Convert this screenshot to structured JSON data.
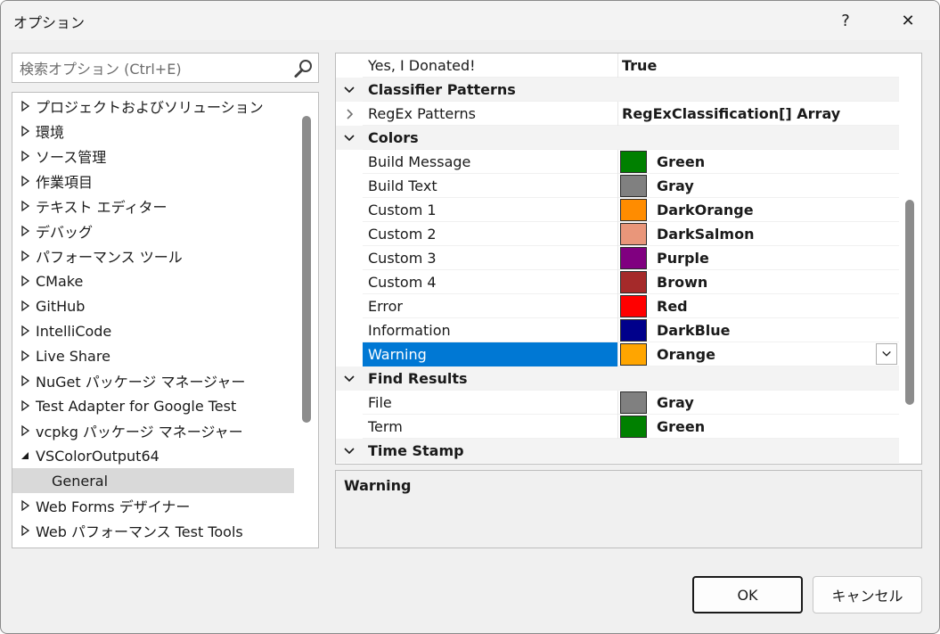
{
  "window": {
    "title": "オプション",
    "help_label": "?",
    "close_label": "✕"
  },
  "search": {
    "placeholder": "検索オプション (Ctrl+E)"
  },
  "tree": {
    "items": [
      {
        "label": "プロジェクトおよびソリューション",
        "state": "collapsed"
      },
      {
        "label": "環境",
        "state": "collapsed"
      },
      {
        "label": "ソース管理",
        "state": "collapsed"
      },
      {
        "label": "作業項目",
        "state": "collapsed"
      },
      {
        "label": "テキスト エディター",
        "state": "collapsed"
      },
      {
        "label": "デバッグ",
        "state": "collapsed"
      },
      {
        "label": "パフォーマンス ツール",
        "state": "collapsed"
      },
      {
        "label": "CMake",
        "state": "collapsed"
      },
      {
        "label": "GitHub",
        "state": "collapsed"
      },
      {
        "label": "IntelliCode",
        "state": "collapsed"
      },
      {
        "label": "Live Share",
        "state": "collapsed"
      },
      {
        "label": "NuGet パッケージ マネージャー",
        "state": "collapsed"
      },
      {
        "label": "Test Adapter for Google Test",
        "state": "collapsed"
      },
      {
        "label": "vcpkg パッケージ マネージャー",
        "state": "collapsed"
      },
      {
        "label": "VSColorOutput64",
        "state": "expanded"
      },
      {
        "label": "General",
        "state": "child-selected"
      },
      {
        "label": "Web Forms デザイナー",
        "state": "collapsed"
      },
      {
        "label": "Web パフォーマンス Test Tools",
        "state": "collapsed"
      }
    ]
  },
  "grid": {
    "rows": [
      {
        "kind": "prop",
        "name": "Yes, I Donated!",
        "value": "True"
      },
      {
        "kind": "category",
        "name": "Classifier Patterns"
      },
      {
        "kind": "prop-expandable",
        "name": "RegEx Patterns",
        "value": "RegExClassification[] Array"
      },
      {
        "kind": "category",
        "name": "Colors"
      },
      {
        "kind": "color",
        "name": "Build Message",
        "value": "Green",
        "color": "#008000"
      },
      {
        "kind": "color",
        "name": "Build Text",
        "value": "Gray",
        "color": "#808080"
      },
      {
        "kind": "color",
        "name": "Custom 1",
        "value": "DarkOrange",
        "color": "#ff8c00"
      },
      {
        "kind": "color",
        "name": "Custom 2",
        "value": "DarkSalmon",
        "color": "#e9967a"
      },
      {
        "kind": "color",
        "name": "Custom 3",
        "value": "Purple",
        "color": "#800080"
      },
      {
        "kind": "color",
        "name": "Custom 4",
        "value": "Brown",
        "color": "#a52a2a"
      },
      {
        "kind": "color",
        "name": "Error",
        "value": "Red",
        "color": "#ff0000"
      },
      {
        "kind": "color",
        "name": "Information",
        "value": "DarkBlue",
        "color": "#00008b"
      },
      {
        "kind": "color-selected",
        "name": "Warning",
        "value": "Orange",
        "color": "#ffa500"
      },
      {
        "kind": "category",
        "name": "Find Results"
      },
      {
        "kind": "color",
        "name": "File",
        "value": "Gray",
        "color": "#808080"
      },
      {
        "kind": "color",
        "name": "Term",
        "value": "Green",
        "color": "#008000"
      },
      {
        "kind": "category",
        "name": "Time Stamp"
      }
    ]
  },
  "description": {
    "title": "Warning"
  },
  "buttons": {
    "ok": "OK",
    "cancel": "キャンセル"
  },
  "colors": {
    "selection": "#0078d4",
    "tree_selected": "#d9d9d9"
  }
}
